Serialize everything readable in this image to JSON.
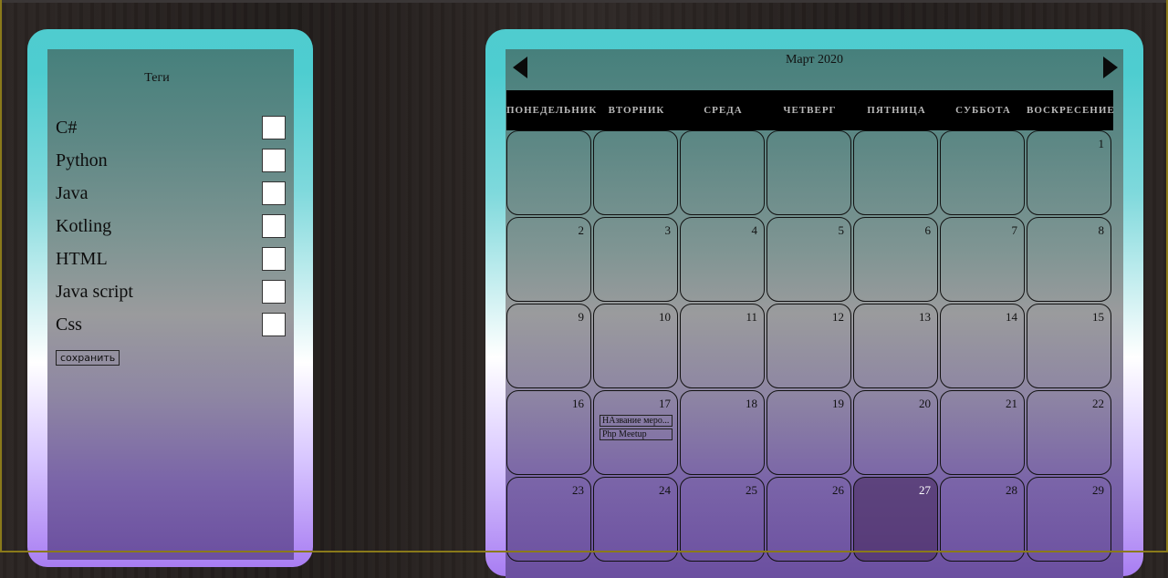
{
  "tags": {
    "title": "Теги",
    "items": [
      {
        "label": "C#",
        "checked": false
      },
      {
        "label": "Python",
        "checked": false
      },
      {
        "label": "Java",
        "checked": false
      },
      {
        "label": "Kotling",
        "checked": false
      },
      {
        "label": "HTML",
        "checked": false
      },
      {
        "label": "Java script",
        "checked": false
      },
      {
        "label": "Css",
        "checked": false
      }
    ],
    "save_label": "сохранить"
  },
  "calendar": {
    "title": "Март 2020",
    "weekdays": [
      "ПОНЕДЕЛЬНИК",
      "ВТОРНИК",
      "СРЕДА",
      "ЧЕТВЕРГ",
      "ПЯТНИЦА",
      "СУББОТА",
      "ВОСКРЕСЕНИЕ"
    ],
    "first_weekday_index": 6,
    "days_shown": 29,
    "today": 27,
    "events": [
      {
        "day": 17,
        "title": "НАзвание меро..."
      },
      {
        "day": 17,
        "title": "Php Meetup"
      }
    ]
  },
  "colors": {
    "frame_top": "#4fcccf",
    "frame_bottom": "#a87df2",
    "weekday_bar": "#000000"
  }
}
